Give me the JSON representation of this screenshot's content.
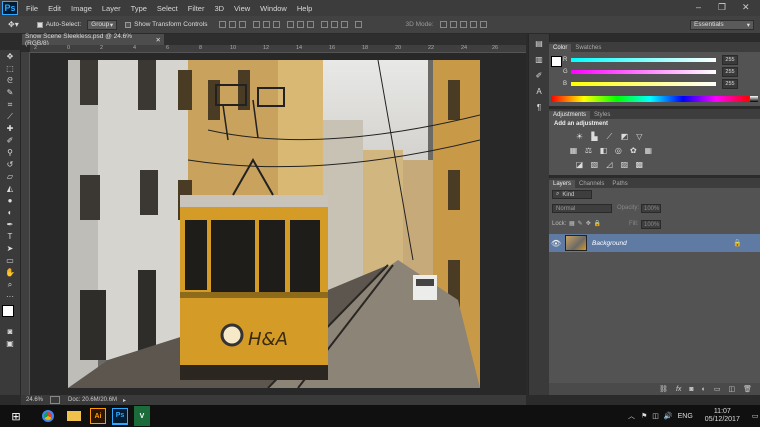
{
  "menubar": {
    "logo": "Ps",
    "items": [
      "File",
      "Edit",
      "Image",
      "Layer",
      "Type",
      "Select",
      "Filter",
      "3D",
      "View",
      "Window",
      "Help"
    ],
    "window_controls": [
      "–",
      "❐",
      "✕"
    ]
  },
  "options": {
    "auto_select_label": "Auto-Select:",
    "auto_select_value": "Group",
    "show_transform_label": "Show Transform Controls",
    "mode_3d_label": "3D Mode:",
    "workspace": "Essentials"
  },
  "document": {
    "tab_title": "Snow Scene Sleekless.psd @ 24.6% (RGB/8)",
    "close": "✕",
    "ruler_ticks": [
      "2",
      "0",
      "2",
      "4",
      "6",
      "8",
      "10",
      "12",
      "14",
      "16",
      "18",
      "20",
      "22",
      "24",
      "26"
    ]
  },
  "status": {
    "zoom": "24.6%",
    "doc_info": "Doc: 20.6M/20.6M"
  },
  "color_panel": {
    "tabs": [
      "Color",
      "Swatches"
    ],
    "channels": [
      {
        "label": "R",
        "value": "255",
        "color": "#00e5ff"
      },
      {
        "label": "G",
        "value": "255",
        "color": "#ff3df2"
      },
      {
        "label": "B",
        "value": "255",
        "color": "#ffe500"
      }
    ]
  },
  "adjustments_panel": {
    "tabs": [
      "Adjustments",
      "Styles"
    ],
    "title": "Add an adjustment",
    "row1_icons": [
      "brightness-icon",
      "levels-icon",
      "curves-icon",
      "exposure-icon",
      "gradient-icon"
    ],
    "row2_icons": [
      "vibrance-icon",
      "balance-icon",
      "bw-icon",
      "photo-filter-icon",
      "channel-mixer-icon",
      "lookup-icon"
    ],
    "row3_icons": [
      "invert-icon",
      "posterize-icon",
      "threshold-icon",
      "gradient-map-icon",
      "selective-color-icon"
    ]
  },
  "layers_panel": {
    "tabs": [
      "Layers",
      "Channels",
      "Paths"
    ],
    "filter_kind": "Kind",
    "blend_mode": "Normal",
    "opacity_label": "Opacity:",
    "opacity_value": "100%",
    "lock_label": "Lock:",
    "fill_label": "Fill:",
    "fill_value": "100%",
    "layers": [
      {
        "name": "Background",
        "visible": true,
        "locked": true
      }
    ],
    "footer_icons": [
      "link-icon",
      "fx-icon",
      "mask-icon",
      "adjustment-layer-icon",
      "folder-icon",
      "new-layer-icon",
      "trash-icon"
    ]
  },
  "taskbar": {
    "apps": [
      "Chrome",
      "Files",
      "Ai",
      "Ps",
      "V"
    ],
    "language": "ENG",
    "time": "11:07",
    "date": "05/12/2017"
  }
}
